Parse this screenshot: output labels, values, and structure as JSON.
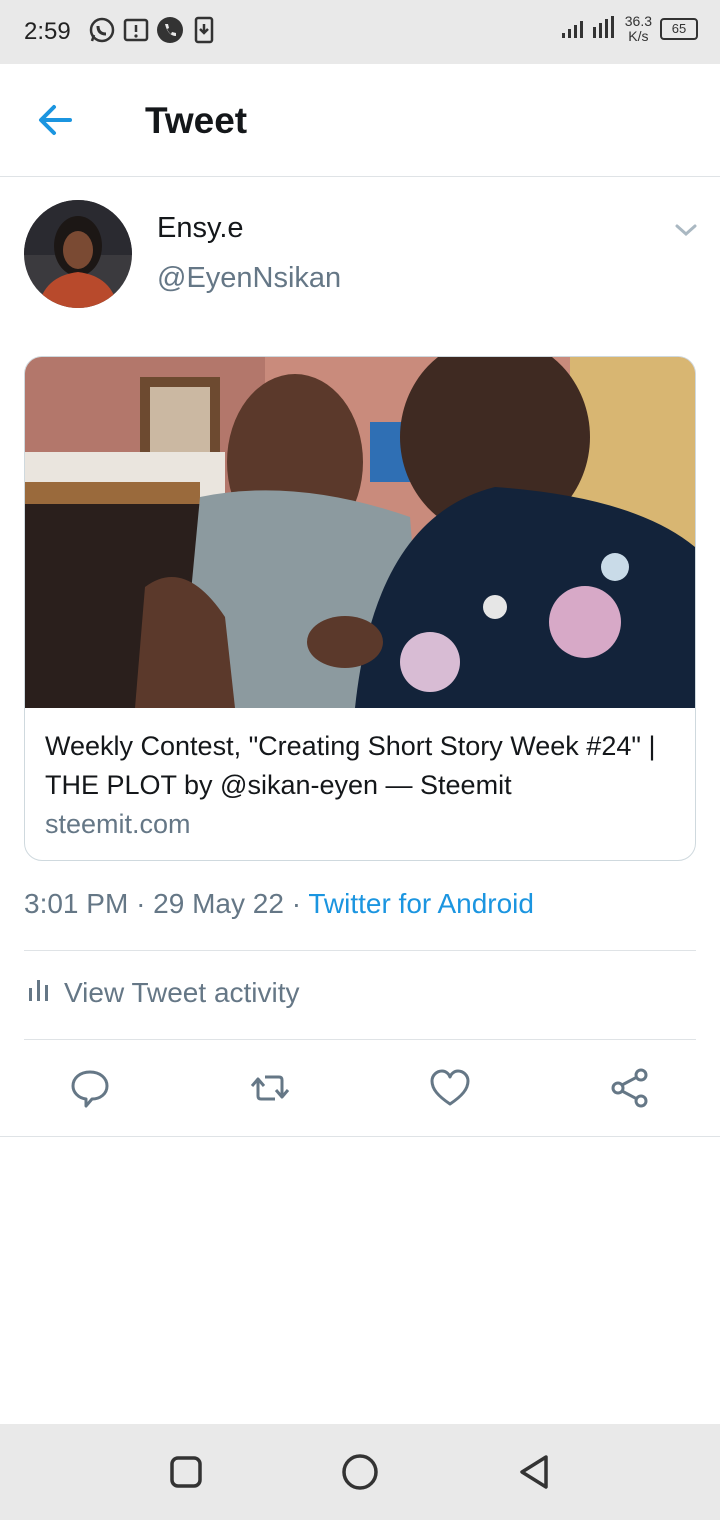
{
  "status_bar": {
    "time": "2:59",
    "speed_value": "36.3",
    "speed_unit": "K/s",
    "battery": "65"
  },
  "app_bar": {
    "title": "Tweet",
    "back_icon": "arrow-left-icon"
  },
  "tweet": {
    "author_name": "Ensy.e",
    "author_handle": "@EyenNsikan",
    "card": {
      "title": "Weekly Contest, \"Creating Short Story Week #24\" | THE PLOT by @sikan-eyen — Steemit",
      "domain": "steemit.com"
    },
    "time": "3:01 PM",
    "date": "29 May 22",
    "separator": "·",
    "source": "Twitter for Android",
    "activity_label": "View Tweet activity"
  },
  "actions": [
    "reply-icon",
    "retweet-icon",
    "like-icon",
    "share-icon"
  ],
  "colors": {
    "accent": "#1b95e0",
    "muted": "#657786",
    "divider": "#dfe3e6"
  }
}
